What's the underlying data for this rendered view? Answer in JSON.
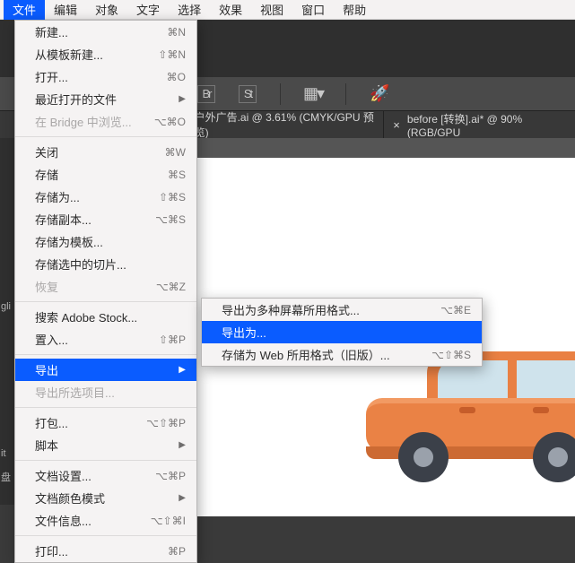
{
  "menubar": {
    "items": [
      "文件",
      "编辑",
      "对象",
      "文字",
      "选择",
      "效果",
      "视图",
      "窗口",
      "帮助"
    ],
    "highlighted": 0
  },
  "toolbar": {
    "icons": [
      "Br",
      "St",
      "grid-icon",
      "rocket-icon"
    ]
  },
  "tabs": [
    {
      "label": "户外广告.ai @ 3.61% (CMYK/GPU 预览)"
    },
    {
      "label": "before [转换].ai* @ 90% (RGB/GPU"
    }
  ],
  "file_menu": [
    {
      "label": "新建...",
      "shortcut": "⌘N"
    },
    {
      "label": "从模板新建...",
      "shortcut": "⇧⌘N"
    },
    {
      "label": "打开...",
      "shortcut": "⌘O"
    },
    {
      "label": "最近打开的文件",
      "submenu": true
    },
    {
      "label": "在 Bridge 中浏览...",
      "shortcut": "⌥⌘O",
      "dim": true
    },
    {
      "sep": true
    },
    {
      "label": "关闭",
      "shortcut": "⌘W"
    },
    {
      "label": "存储",
      "shortcut": "⌘S"
    },
    {
      "label": "存储为...",
      "shortcut": "⇧⌘S"
    },
    {
      "label": "存储副本...",
      "shortcut": "⌥⌘S"
    },
    {
      "label": "存储为模板..."
    },
    {
      "label": "存储选中的切片..."
    },
    {
      "label": "恢复",
      "shortcut": "⌥⌘Z",
      "dim": true
    },
    {
      "sep": true
    },
    {
      "label": "搜索 Adobe Stock..."
    },
    {
      "label": "置入...",
      "shortcut": "⇧⌘P"
    },
    {
      "sep": true
    },
    {
      "label": "导出",
      "submenu": true,
      "hl": true
    },
    {
      "label": "导出所选项目...",
      "dim": true
    },
    {
      "sep": true
    },
    {
      "label": "打包...",
      "shortcut": "⌥⇧⌘P"
    },
    {
      "label": "脚本",
      "submenu": true
    },
    {
      "sep": true
    },
    {
      "label": "文档设置...",
      "shortcut": "⌥⌘P"
    },
    {
      "label": "文档颜色模式",
      "submenu": true
    },
    {
      "label": "文件信息...",
      "shortcut": "⌥⇧⌘I"
    },
    {
      "sep": true
    },
    {
      "label": "打印...",
      "shortcut": "⌘P"
    }
  ],
  "export_menu": [
    {
      "label": "导出为多种屏幕所用格式...",
      "shortcut": "⌥⌘E"
    },
    {
      "label": "导出为...",
      "hl": true
    },
    {
      "label": "存储为 Web 所用格式（旧版）...",
      "shortcut": "⌥⇧⌘S"
    }
  ],
  "left_fragments": [
    "gli",
    "it",
    "盘"
  ]
}
